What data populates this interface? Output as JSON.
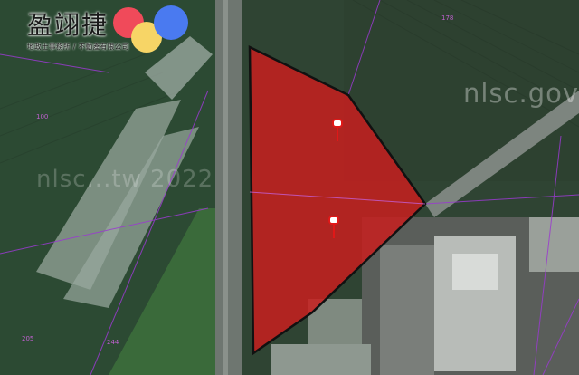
{
  "logo": {
    "brand": "盈翊捷",
    "subtitle": "地政士事務所 / 不動產有限公司",
    "dot_colors": [
      "#f04a5a",
      "#f7d566",
      "#4a7af0"
    ]
  },
  "watermarks": {
    "right": "nlsc.gov",
    "center": "nlsc...tw 2022"
  },
  "parcels": [
    "178",
    "205",
    "244",
    "100"
  ],
  "highlight": {
    "fill": "#c81e1e",
    "stroke": "#111111"
  },
  "markers": [
    "pin-icon",
    "pin-icon"
  ]
}
